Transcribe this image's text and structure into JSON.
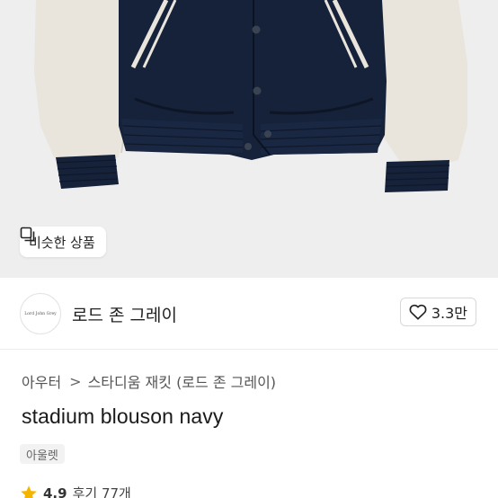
{
  "hero": {
    "image_alt_icon": "jacket-product-photo",
    "similar_button": {
      "icon": "similar-items-icon",
      "label": "비슷한 상품"
    }
  },
  "store": {
    "avatar_text": "Lord John Grey",
    "name": "로드 존 그레이",
    "like_icon": "heart-outline-icon",
    "like_count": "3.3만"
  },
  "breadcrumb": [
    {
      "label": "아우터"
    },
    {
      "label": "스타디움 재킷 (로드 존 그레이)"
    }
  ],
  "breadcrumb_separator": ">",
  "product": {
    "title": "stadium blouson navy",
    "tag": "아울렛"
  },
  "rating": {
    "star_icon": "star-icon",
    "score": "4.9",
    "reviews": "후기 77개"
  },
  "colors": {
    "accent_star": "#f5b400",
    "jacket_body": "#16223a",
    "jacket_sleeve": "#e9e5dc",
    "background_hero": "#eeeeee"
  }
}
